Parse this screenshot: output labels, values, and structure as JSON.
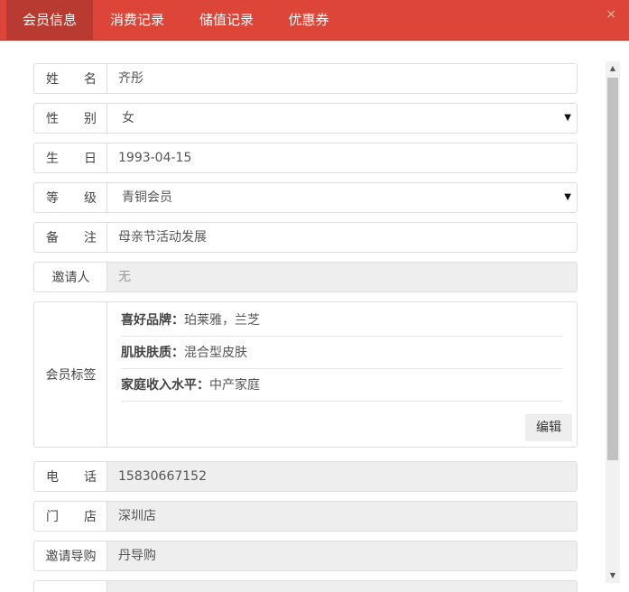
{
  "tabs": [
    {
      "label": "会员信息",
      "active": true
    },
    {
      "label": "消费记录",
      "active": false
    },
    {
      "label": "储值记录",
      "active": false
    },
    {
      "label": "优惠券",
      "active": false
    }
  ],
  "close_icon": "×",
  "form": {
    "name": {
      "label_a": "姓",
      "label_b": "名",
      "value": "齐彤"
    },
    "gender": {
      "label_a": "性",
      "label_b": "别",
      "value": "女",
      "caret": "▼"
    },
    "birthday": {
      "label_a": "生",
      "label_b": "日",
      "value": "1993-04-15"
    },
    "level": {
      "label_a": "等",
      "label_b": "级",
      "value": "青铜会员",
      "caret": "▼"
    },
    "remark": {
      "label_a": "备",
      "label_b": "注",
      "value": "母亲节活动发展"
    },
    "inviter": {
      "label": "邀请人",
      "value": "无"
    },
    "tags": {
      "label": "会员标签",
      "items": [
        {
          "key": "喜好品牌：",
          "value": "珀莱雅，兰芝"
        },
        {
          "key": "肌肤肤质：",
          "value": "混合型皮肤"
        },
        {
          "key": "家庭收入水平：",
          "value": "中产家庭"
        }
      ],
      "edit_label": "编辑"
    },
    "phone": {
      "label_a": "电",
      "label_b": "话",
      "value": "15830667152"
    },
    "store": {
      "label_a": "门",
      "label_b": "店",
      "value": "深圳店"
    },
    "guide": {
      "label": "邀请导购",
      "value": "丹导购"
    }
  },
  "colors": {
    "accent": "#dd4538",
    "active_tab": "#b83a30"
  }
}
